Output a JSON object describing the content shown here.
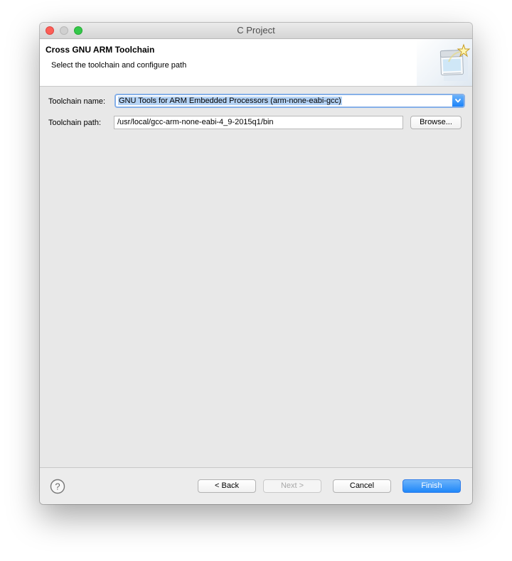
{
  "window": {
    "title": "C Project"
  },
  "header": {
    "title": "Cross GNU ARM Toolchain",
    "description": "Select the toolchain and configure path",
    "wizard_icon": "wizard-banner-icon"
  },
  "form": {
    "toolchain_name_label": "Toolchain name:",
    "toolchain_name_value": "GNU Tools for ARM Embedded Processors (arm-none-eabi-gcc)",
    "toolchain_path_label": "Toolchain path:",
    "toolchain_path_value": "/usr/local/gcc-arm-none-eabi-4_9-2015q1/bin",
    "browse_label": "Browse..."
  },
  "footer": {
    "help_icon": "help-icon",
    "back_label": "< Back",
    "next_label": "Next >",
    "cancel_label": "Cancel",
    "finish_label": "Finish"
  },
  "colors": {
    "accent": "#1f87f9",
    "selection": "#b4d2f4",
    "close": "#fc5f57",
    "maximize": "#34c84a"
  }
}
